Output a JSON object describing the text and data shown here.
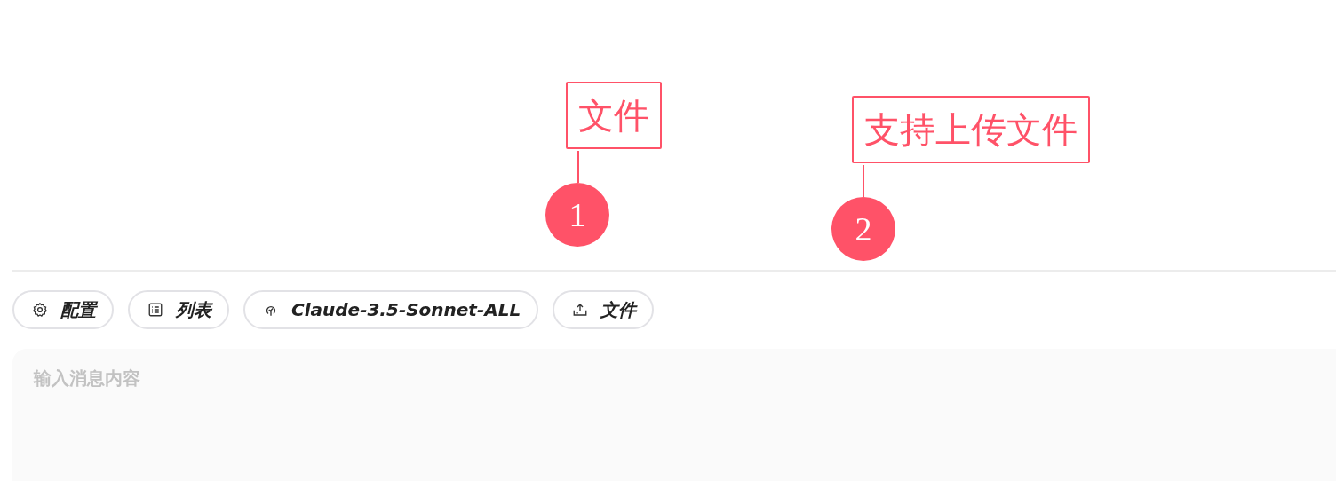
{
  "callouts": [
    {
      "number": "1",
      "label": "文件"
    },
    {
      "number": "2",
      "label": "支持上传文件"
    }
  ],
  "toolbar": [
    {
      "label": "配置"
    },
    {
      "label": "列表"
    },
    {
      "label": "Claude-3.5-Sonnet-ALL"
    },
    {
      "label": "文件"
    }
  ],
  "message_input": {
    "placeholder": "输入消息内容"
  }
}
